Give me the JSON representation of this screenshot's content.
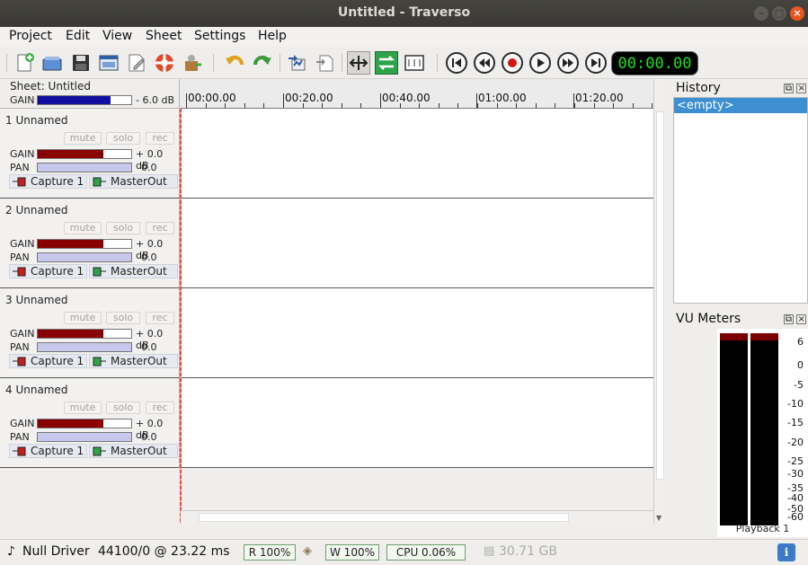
{
  "window": {
    "title": "Untitled - Traverso"
  },
  "menu": [
    "Project",
    "Edit",
    "View",
    "Sheet",
    "Settings",
    "Help"
  ],
  "transport": {
    "time": "00:00.00"
  },
  "sheet": {
    "label": "Sheet: Untitled",
    "gain_label": "GAIN",
    "gain_value": "- 6.0 dB",
    "gain_level": 0.78
  },
  "ruler": {
    "labels": [
      "00:00.00",
      "00:20.00",
      "00:40.00",
      "01:00.00",
      "01:20.00"
    ]
  },
  "tracks": [
    {
      "name": "1 Unnamed",
      "mute": "mute",
      "solo": "solo",
      "rec": "rec",
      "gain_label": "GAIN",
      "gain_value": "+ 0.0 dB",
      "gain_level": 0.7,
      "pan_label": "PAN",
      "pan_value": "0.0",
      "input": "Capture 1",
      "output": "MasterOut"
    },
    {
      "name": "2 Unnamed",
      "mute": "mute",
      "solo": "solo",
      "rec": "rec",
      "gain_label": "GAIN",
      "gain_value": "+ 0.0 dB",
      "gain_level": 0.7,
      "pan_label": "PAN",
      "pan_value": "0.0",
      "input": "Capture 1",
      "output": "MasterOut"
    },
    {
      "name": "3 Unnamed",
      "mute": "mute",
      "solo": "solo",
      "rec": "rec",
      "gain_label": "GAIN",
      "gain_value": "+ 0.0 dB",
      "gain_level": 0.7,
      "pan_label": "PAN",
      "pan_value": "0.0",
      "input": "Capture 1",
      "output": "MasterOut"
    },
    {
      "name": "4 Unnamed",
      "mute": "mute",
      "solo": "solo",
      "rec": "rec",
      "gain_label": "GAIN",
      "gain_value": "+ 0.0 dB",
      "gain_level": 0.7,
      "pan_label": "PAN",
      "pan_value": "0.0",
      "input": "Capture 1",
      "output": "MasterOut"
    }
  ],
  "history": {
    "title": "History",
    "items": [
      "<empty>"
    ]
  },
  "vu": {
    "title": "VU Meters",
    "scale": [
      "6",
      "0",
      "-5",
      "-10",
      "-15",
      "-20",
      "-25",
      "-30",
      "-35",
      "-40",
      "-50",
      "-60"
    ],
    "label": "Playback 1"
  },
  "status": {
    "driver": "Null Driver",
    "rate": "44100/0 @ 23.22 ms",
    "read": "R 100%",
    "write": "W 100%",
    "cpu": "CPU 0.06%",
    "disk": "30.71 GB"
  },
  "colors": {
    "gain_sheet": "#1010a0",
    "gain_track": "#880000",
    "pan": "#c8c8ec",
    "accent": "#3d8fd1",
    "clock": "#20e020"
  }
}
